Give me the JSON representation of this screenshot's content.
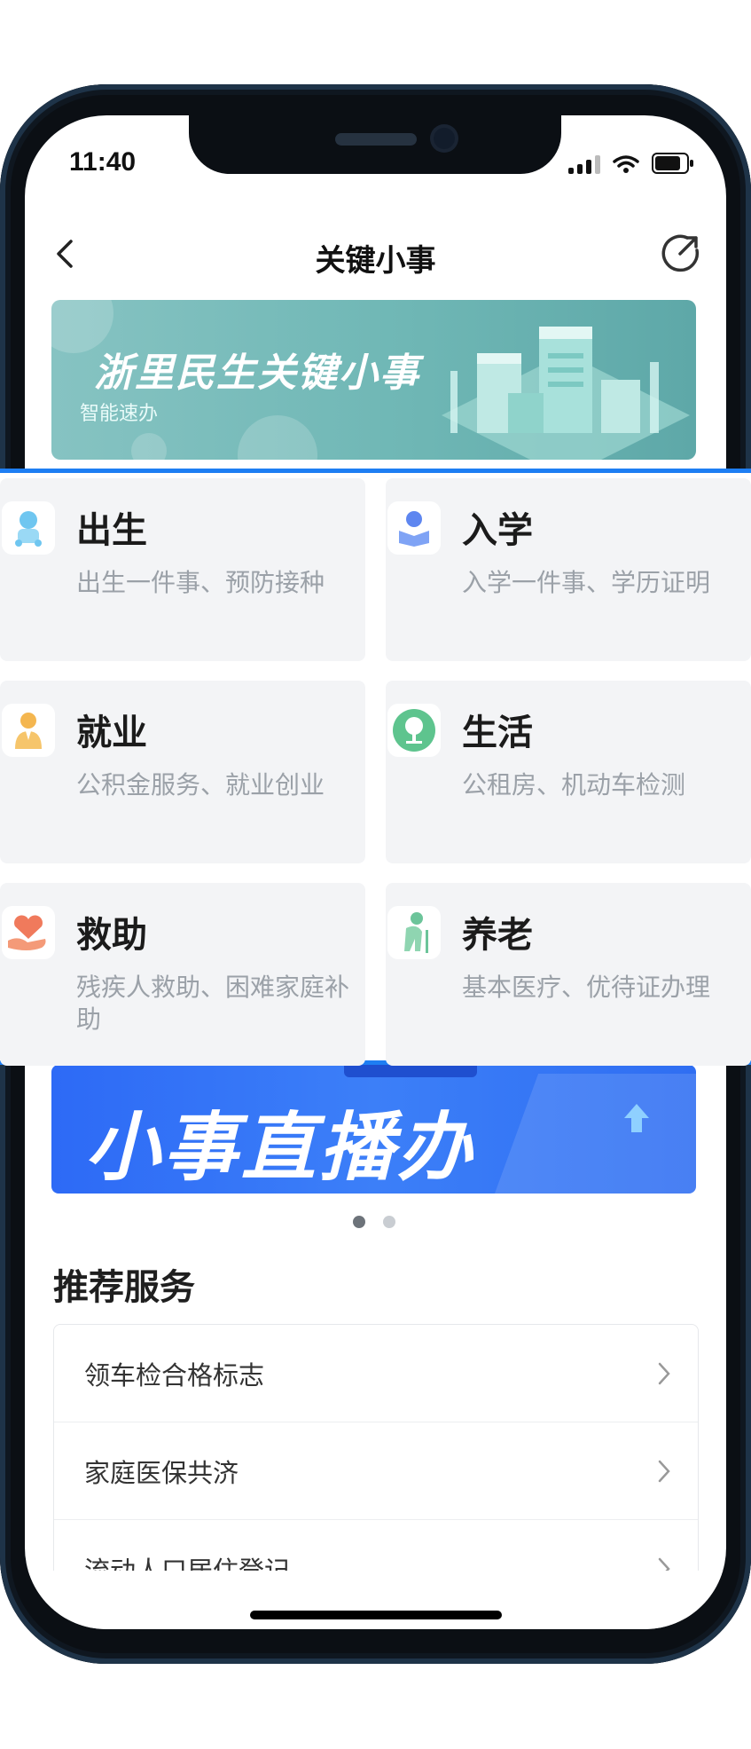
{
  "status_bar": {
    "time": "11:40"
  },
  "header": {
    "title": "关键小事"
  },
  "banner": {
    "title": "浙里民生关键小事",
    "subtitle": "智能速办"
  },
  "categories": [
    {
      "title": "出生",
      "desc": "出生一件事、预防接种",
      "icon": "baby-icon"
    },
    {
      "title": "入学",
      "desc": "入学一件事、学历证明",
      "icon": "student-icon"
    },
    {
      "title": "就业",
      "desc": "公积金服务、就业创业",
      "icon": "worker-icon"
    },
    {
      "title": "生活",
      "desc": "公租房、机动车检测",
      "icon": "tree-icon"
    },
    {
      "title": "救助",
      "desc": "残疾人救助、困难家庭补助",
      "icon": "heart-hand-icon"
    },
    {
      "title": "养老",
      "desc": "基本医疗、优待证办理",
      "icon": "elder-icon"
    }
  ],
  "live_banner": {
    "title": "小事直播办"
  },
  "carousel": {
    "count": 2,
    "active_index": 0
  },
  "recommend": {
    "title": "推荐服务",
    "items": [
      {
        "label": "领车检合格标志"
      },
      {
        "label": "家庭医保共济"
      },
      {
        "label": "流动人口居住登记"
      }
    ]
  },
  "colors": {
    "accent": "#1e7ef3",
    "banner": "#6fb7b5",
    "live_banner": "#2f6ef2"
  }
}
